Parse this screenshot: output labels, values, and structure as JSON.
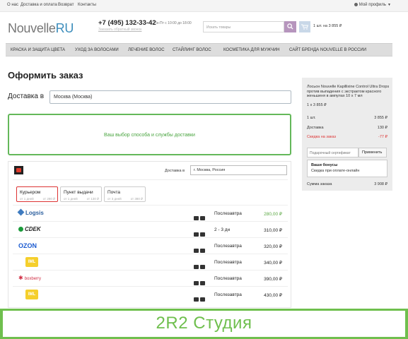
{
  "top_links": [
    "О нас",
    "Доставка и оплата",
    "Возврат",
    "Контакты"
  ],
  "profile_label": "Мой профиль",
  "logo": {
    "part1": "Nouvelle",
    "part2": "RU"
  },
  "phone": "+7 (495) 132-33-42",
  "hours": "Пн-Пт с 10:00 до 18:00",
  "callback": "Заказать обратный звонок",
  "search_placeholder": "Искать товары",
  "cart_summary": "1 шт. на 3 855 ₽",
  "nav": [
    "КРАСКА И ЗАЩИТА ЦВЕТА",
    "УХОД ЗА ВОЛОСАМИ",
    "ЛЕЧЕНИЕ ВОЛОС",
    "СТАЙЛИНГ ВОЛОС",
    "КОСМЕТИКА ДЛЯ МУЖЧИН",
    "САЙТ БРЕНДА NOUVELLE В РОССИИ"
  ],
  "page_title": "Оформить заказ",
  "delivery_label": "Доставка в",
  "delivery_city": "Москва (Москва)",
  "shipping_prompt": "Ваш выбор способа и службы доставки",
  "widget": {
    "label": "Доставка в",
    "city": "г. Москва, Россия",
    "tabs": [
      {
        "name": "Курьером",
        "days": "от 1 дней",
        "price": "от 280 ₽"
      },
      {
        "name": "Пункт выдачи",
        "days": "от 1 дней",
        "price": "от 130 ₽"
      },
      {
        "name": "Почта",
        "days": "от 3 дней",
        "price": "от 380 ₽"
      }
    ],
    "rows": [
      {
        "carrier": "Logsis",
        "day": "Послезавтра",
        "price": "280,00 ₽"
      },
      {
        "carrier": "CDEK",
        "day": "2 - 3 дн",
        "price": "310,00 ₽"
      },
      {
        "carrier": "OZON",
        "day": "Послезавтра",
        "price": "320,00 ₽"
      },
      {
        "carrier": "IML",
        "day": "Послезавтра",
        "price": "340,00 ₽"
      },
      {
        "carrier": "boxberry",
        "day": "Послезавтра",
        "price": "390,00 ₽"
      },
      {
        "carrier": "IML",
        "day": "Послезавтра",
        "price": "430,00 ₽"
      }
    ]
  },
  "summary": {
    "product": "Лосьон Nouvelle Kapillixine Control Ultra Drops против выпадения с экстрактом красного женьшеня в ампулах 10 х 7 мл",
    "qty_line": "1 x 3 855 ₽",
    "count": "1 шт.",
    "count_val": "3 855 ₽",
    "delivery": "Доставка",
    "delivery_val": "130 ₽",
    "discount": "Скидка на заказ",
    "discount_val": "-77 ₽",
    "cert_placeholder": "Подарочный сертификат",
    "apply": "Применить",
    "bonus_title": "Ваши бонусы",
    "bonus_text": "Скидка при оплате-онлайн",
    "total": "Сумма заказа",
    "total_val": "3 908 ₽"
  },
  "banner": "2R2 Студия",
  "colors": {
    "accent_green": "#6fbf4e",
    "discount_red": "#dd3333",
    "logo_blue": "#3c8dbc"
  }
}
